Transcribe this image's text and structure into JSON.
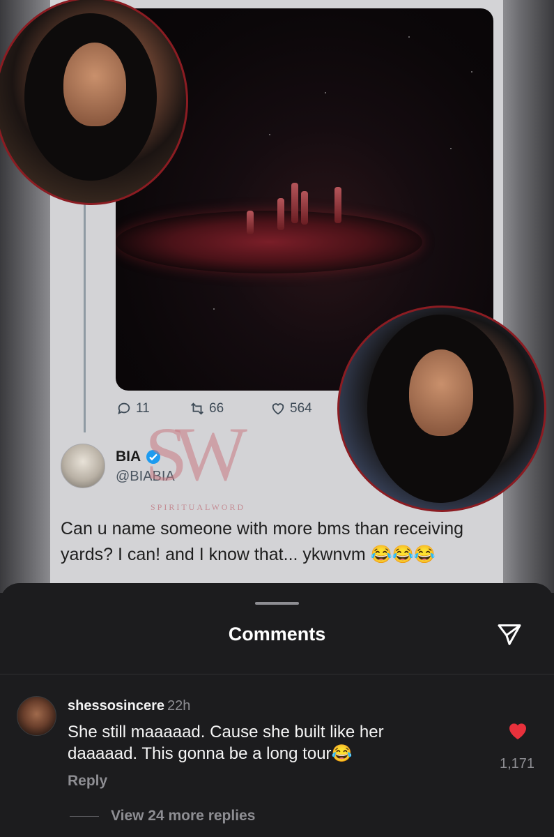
{
  "tweet": {
    "stats": {
      "replies": "11",
      "retweets": "66",
      "likes": "564"
    },
    "author": {
      "name": "BIA",
      "handle": "@BIABIA"
    },
    "text": "Can u name someone with more bms than receiving yards? I can! and I know that... ykwnvm 😂😂😂"
  },
  "watermark": {
    "mark": "SW",
    "label": "SPIRITUALWORD"
  },
  "comments_sheet": {
    "title": "Comments",
    "comment": {
      "username": "shessosincere",
      "time": "22h",
      "text": "She still maaaaad. Cause she built like her daaaaad. This gonna be a long tour😂",
      "reply_label": "Reply",
      "like_count": "1,171",
      "view_replies": "View 24 more replies"
    }
  },
  "icons": {
    "reply": "reply-bubble-icon",
    "retweet": "retweet-icon",
    "like": "heart-outline-icon",
    "verified": "verified-badge-icon",
    "share": "send-paper-plane-icon",
    "comment_like": "heart-filled-icon"
  },
  "colors": {
    "sheet_bg": "#1c1c1e",
    "like_red": "#e8313c",
    "verified_blue": "#1d9bf0",
    "watermark_pink": "#c87882",
    "inset_border": "#8b1c22"
  }
}
